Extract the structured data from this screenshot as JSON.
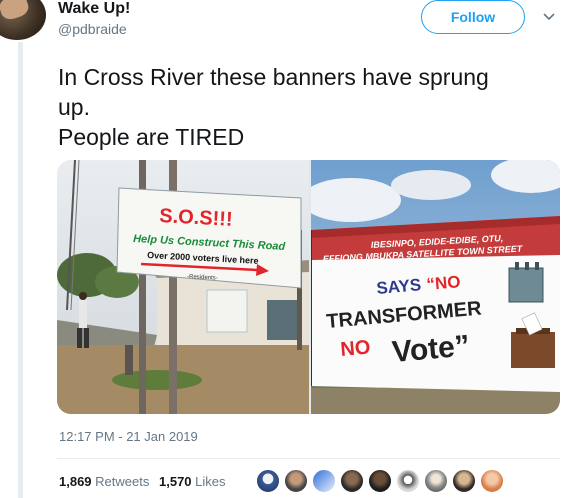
{
  "user": {
    "display_name": "Wake Up!",
    "handle": "@pdbraide"
  },
  "follow_label": "Follow",
  "tweet": {
    "lines": [
      "In Cross River these banners have sprung",
      "up.",
      "People are TIRED"
    ]
  },
  "media": {
    "left_banner": {
      "title": "S.O.S!!!",
      "line1": "Help Us Construct This Road",
      "line2": "Over 2000 voters live here",
      "line3": "-Residents-"
    },
    "right_banner": {
      "header1": "IBESINPO, EDIDE-EDIBE, OTU,",
      "header2": "EFFIONG MBUKPA SATELLITE TOWN STREET",
      "says": "SAYS",
      "no1": "“NO",
      "transformer": "TRANSFORMER",
      "no2": "NO",
      "vote": "Vote”"
    }
  },
  "timestamp": "12:17 PM - 21 Jan 2019",
  "stats": {
    "retweets_count": "1,869",
    "retweets_label": "Retweets",
    "likes_count": "1,570",
    "likes_label": "Likes"
  },
  "colors": {
    "accent": "#1da1f2",
    "text": "#14171a",
    "muted": "#657786"
  },
  "icons": {
    "chevron": "chevron-down-icon"
  }
}
